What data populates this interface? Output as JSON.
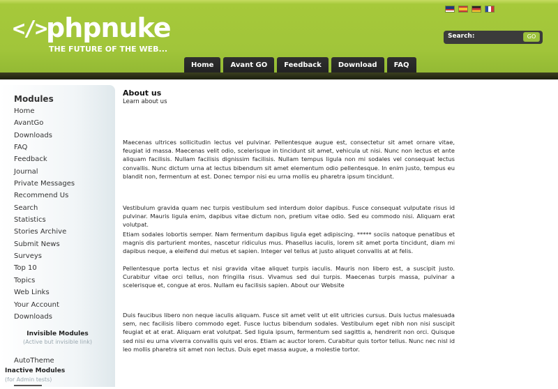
{
  "header": {
    "logo_icon": "</>",
    "logo_text": "phpnuke",
    "tagline": "THE FUTURE OF THE WEB...",
    "flags": [
      "us",
      "es",
      "de",
      "fr"
    ],
    "search": {
      "label": "Search:",
      "value": "",
      "button": "GO"
    },
    "nav": [
      "Home",
      "Avant GO",
      "Feedback",
      "Download",
      "FAQ"
    ]
  },
  "sidebar": {
    "title": "Modules",
    "modules": [
      "Home",
      "AvantGo",
      "Downloads",
      "FAQ",
      "Feedback",
      "Journal",
      "Private Messages",
      "Recommend Us",
      "Search",
      "Statistics",
      "Stories Archive",
      "Submit News",
      "Surveys",
      "Top 10",
      "Topics",
      "Web Links",
      "Your Account",
      "Downloads"
    ],
    "invisible_title": "Invisible Modules",
    "invisible_note": "(Active but invisible link)",
    "invisible_items": [
      "AutoTheme"
    ],
    "inactive_title": "Inactive Modules",
    "inactive_note": "(for Admin tests)"
  },
  "main": {
    "title": "About us",
    "subtitle": "Learn about us",
    "paragraphs": [
      "Maecenas ultrices sollicitudin lectus vel pulvinar. Pellentesque augue est, consectetur sit amet ornare vitae, feugiat id massa. Maecenas velit odio, scelerisque in tincidunt sit amet, vehicula ut nisi. Nunc non lectus et ante aliquam facilisis. Nullam facilisis dignissim facilisis. Nullam tempus ligula non mi sodales vel consequat lectus convallis. Nunc dictum urna at lectus bibendum sit amet elementum odio pellentesque. In enim justo, tempus eu blandit non, fermentum at est. Donec tempor nisi eu urna mollis eu pharetra ipsum tincidunt.",
      "Vestibulum gravida quam nec turpis vestibulum sed interdum dolor dapibus. Fusce consequat vulputate risus id pulvinar. Mauris ligula enim, dapibus vitae dictum non, pretium vitae odio. Sed eu commodo nisi. Aliquam erat volutpat.",
      "Etiam sodales lobortis semper. Nam fermentum dapibus ligula eget adipiscing. ***** sociis natoque penatibus et magnis dis parturient montes, nascetur ridiculus mus. Phasellus iaculis, lorem sit amet porta tincidunt, diam mi dapibus neque, a eleifend dui metus et sapien. Integer vel tellus at justo aliquet convallis at at felis.",
      "Pellentesque porta lectus et nisi gravida vitae aliquet turpis iaculis. Mauris non libero est, a suscipit justo. Curabitur vitae orci tellus, non fringilla risus. Vivamus sed dui turpis. Maecenas turpis massa, pulvinar a scelerisque et, congue at eros. Nullam eu facilisis sapien. About our Website",
      "Duis faucibus libero non neque iaculis aliquam. Fusce sit amet velit ut elit ultricies cursus. Duis luctus malesuada sem, nec facilisis libero commodo eget. Fusce luctus bibendum sodales. Vestibulum eget nibh non nisi suscipit feugiat et at erat. Aliquam erat volutpat. Sed ligula ipsum, fermentum sed sagittis a, hendrerit non orci. Quisque sed nisi eu urna viverra convallis quis vel eros. Etiam ac auctor lorem. Curabitur quis tortor tellus. Nunc nec nisl id leo mollis pharetra sit amet non lectus. Duis eget massa augue, a molestie tortor."
    ]
  },
  "colors": {
    "header_green": "#a1c53a",
    "nav_dark": "#2a2a2a",
    "header_bar": "#232611"
  }
}
